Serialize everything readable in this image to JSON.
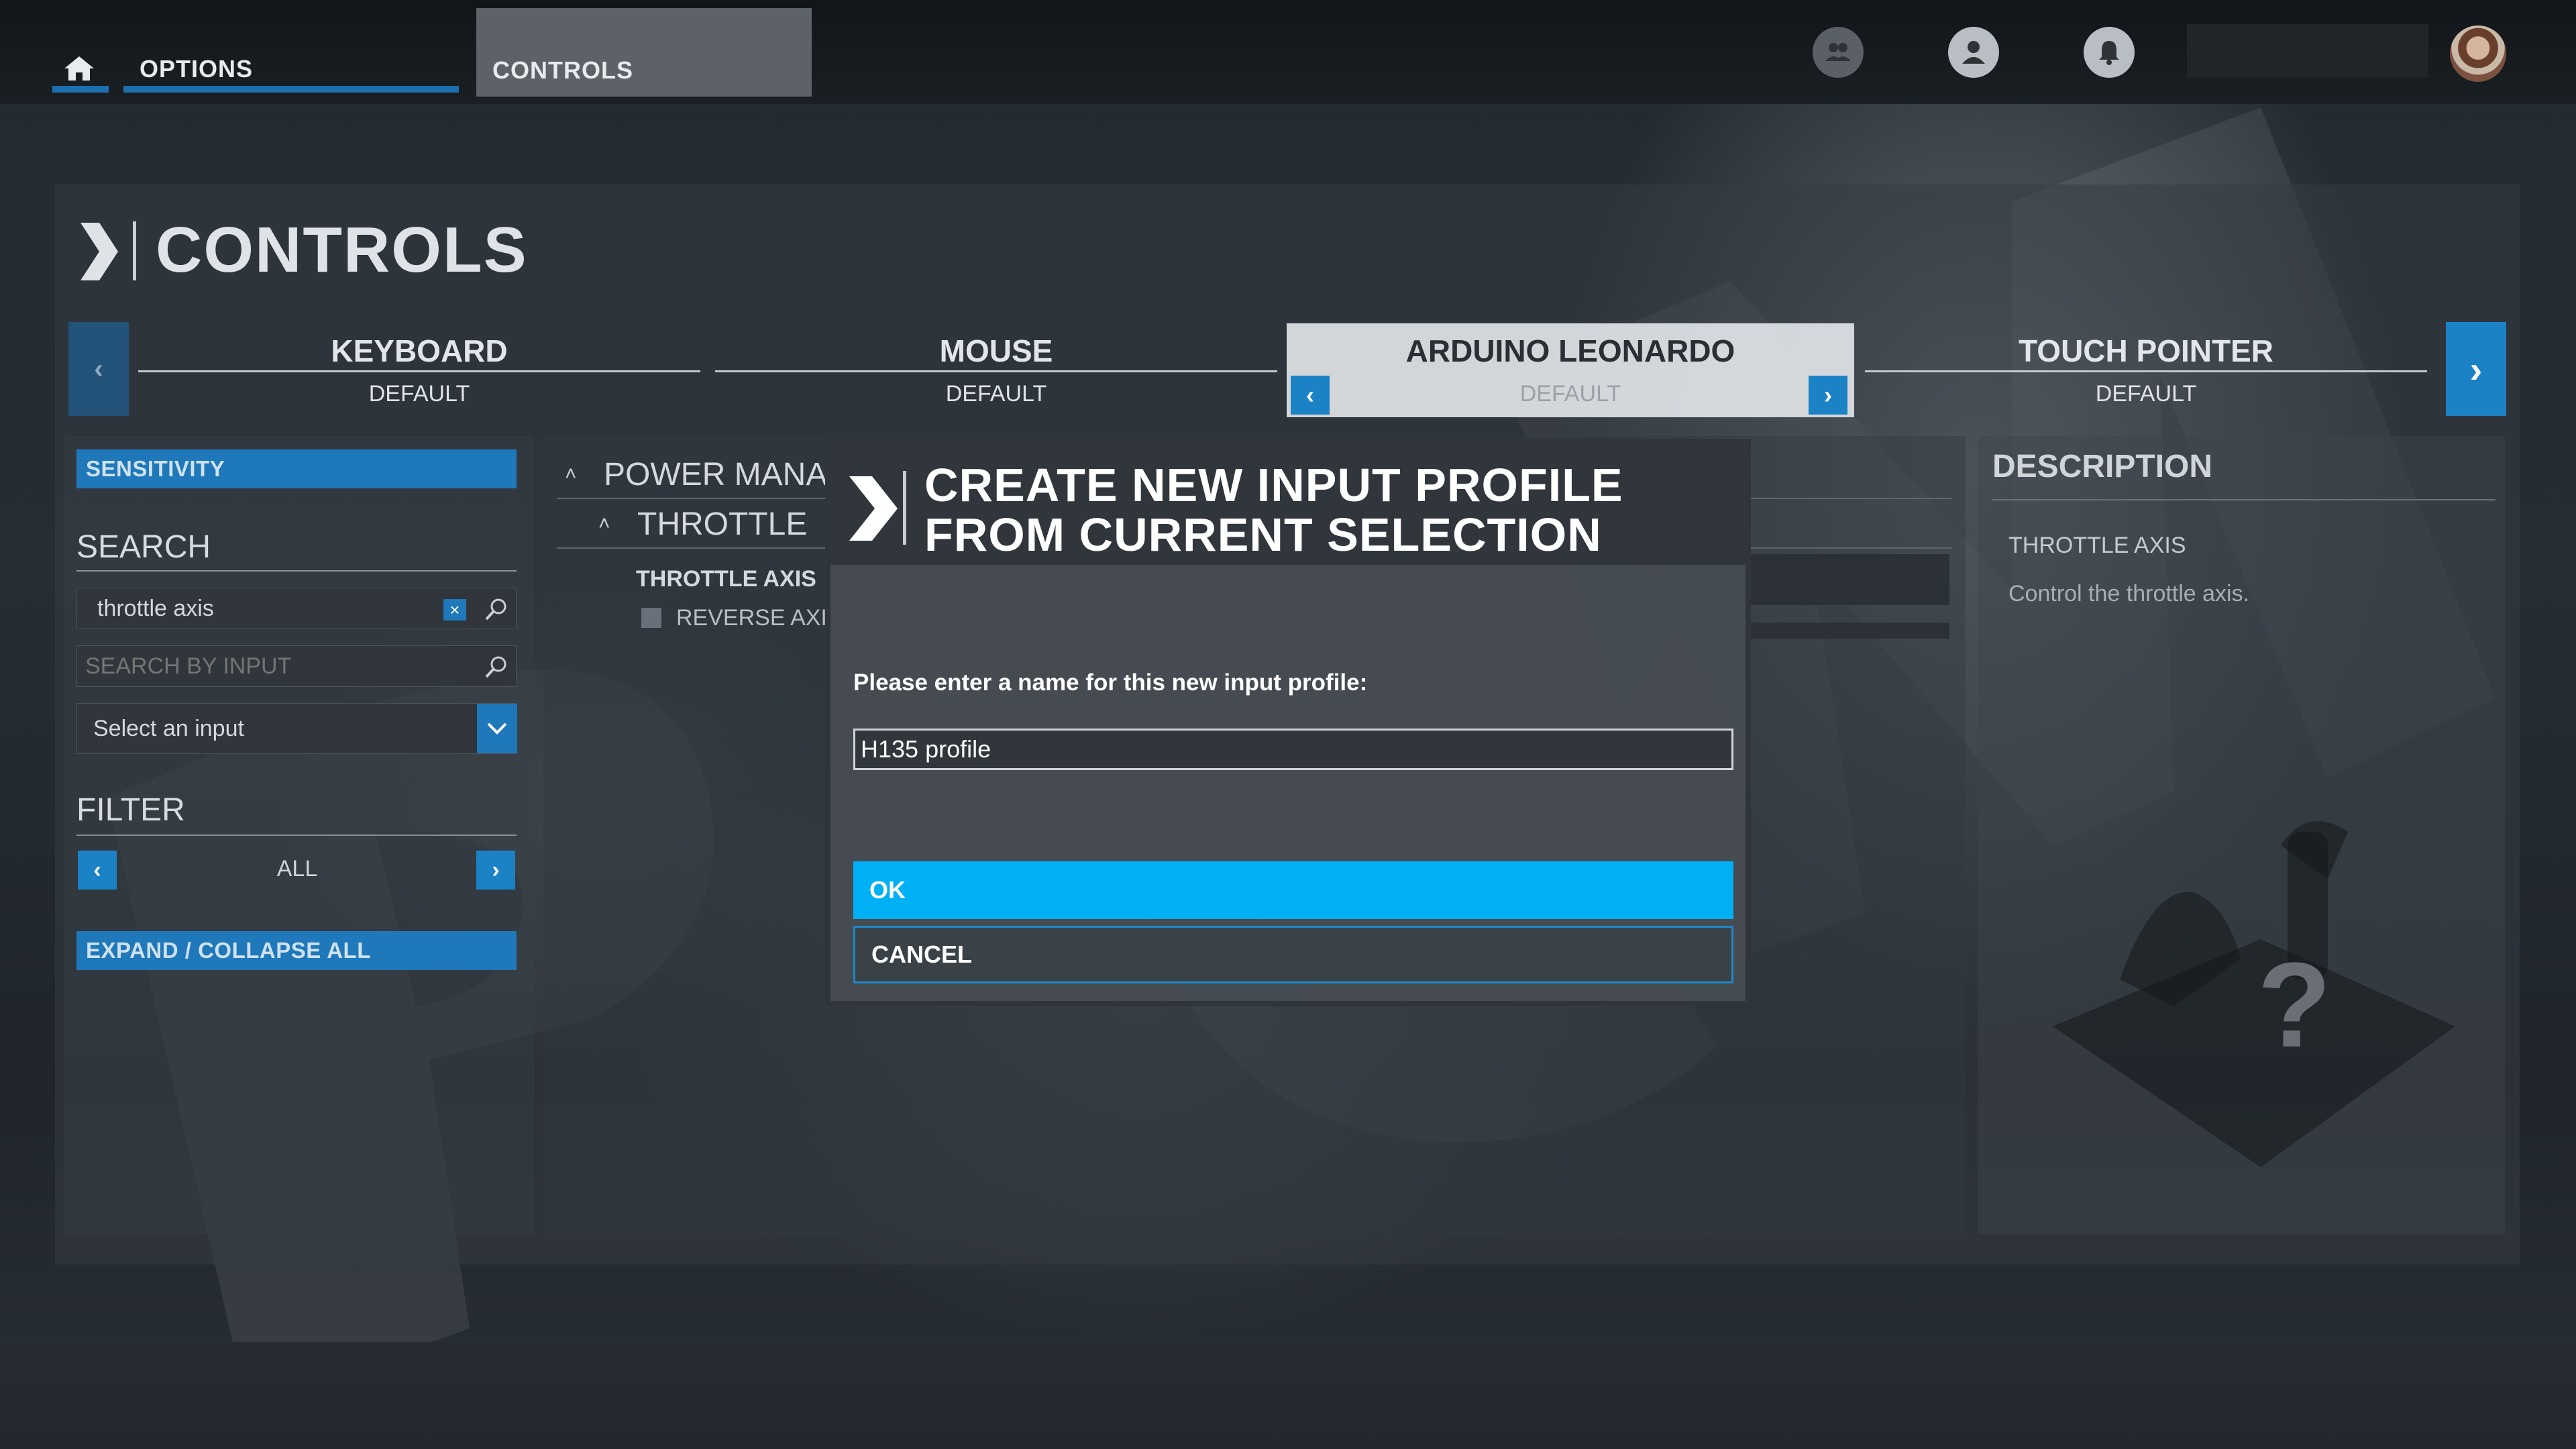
{
  "nav": {
    "options_label": "OPTIONS",
    "controls_label": "CONTROLS"
  },
  "page": {
    "title": "CONTROLS"
  },
  "devices": [
    {
      "name": "KEYBOARD",
      "profile": "DEFAULT"
    },
    {
      "name": "MOUSE",
      "profile": "DEFAULT"
    },
    {
      "name": "ARDUINO LEONARDO",
      "profile": "DEFAULT"
    },
    {
      "name": "TOUCH POINTER",
      "profile": "DEFAULT"
    }
  ],
  "sidebar": {
    "sensitivity_label": "SENSITIVITY",
    "search_heading": "SEARCH",
    "search_value": "throttle axis",
    "search_input_placeholder": "SEARCH BY INPUT",
    "select_input_label": "Select an input",
    "filter_heading": "FILTER",
    "filter_value": "ALL",
    "expand_collapse_label": "EXPAND / COLLAPSE ALL"
  },
  "middle": {
    "category_label": "POWER MANAG",
    "subcategory_label": "THROTTLE",
    "item_label": "THROTTLE AXIS",
    "reverse_label": "REVERSE AXI"
  },
  "description": {
    "heading": "DESCRIPTION",
    "item_title": "THROTTLE AXIS",
    "text": "Control the throttle axis.",
    "placeholder_glyph": "?"
  },
  "dialog": {
    "title": "CREATE NEW INPUT PROFILE FROM CURRENT SELECTION",
    "prompt": "Please enter a name for this new input profile:",
    "input_value": "H135 profile",
    "ok_label": "OK",
    "cancel_label": "CANCEL"
  },
  "colors": {
    "accent": "#1e78b9",
    "ok_button": "#00b0f5",
    "active_tab": "#e1e4e7"
  }
}
